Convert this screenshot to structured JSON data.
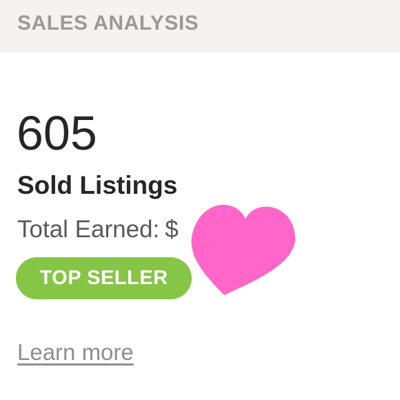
{
  "header": {
    "title": "SALES ANALYSIS"
  },
  "metric": {
    "value": "605",
    "label": "Sold Listings"
  },
  "earnings": {
    "label": "Total Earned:",
    "value": "$"
  },
  "badge": {
    "text": "TOP SELLER",
    "color": "#86c545"
  },
  "link": {
    "text": "Learn more"
  },
  "overlay": {
    "icon": "heart-icon",
    "color": "#ff66c8"
  },
  "colors": {
    "header_bg": "#f5f3ef",
    "title_text": "#9c9a98",
    "primary_text": "#262626",
    "secondary_text": "#595959",
    "link_text": "#8e8e8e"
  }
}
